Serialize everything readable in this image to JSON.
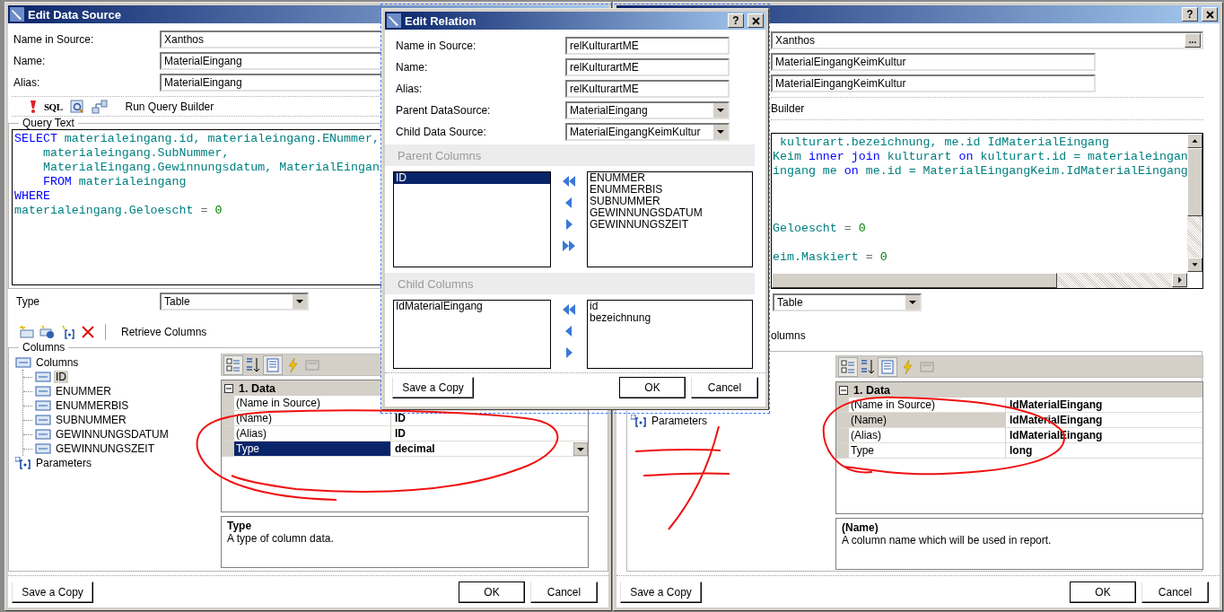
{
  "left_window": {
    "title": "Edit Data Source",
    "fields": [
      {
        "label": "Name in Source:",
        "value": "Xanthos"
      },
      {
        "label": "Name:",
        "value": "MaterialEingang"
      },
      {
        "label": "Alias:",
        "value": "MaterialEingang"
      }
    ],
    "toolbar": {
      "sql": "SQL",
      "label": "Run Query Builder"
    },
    "query": {
      "title": "Query Text",
      "lines": [
        {
          "kind": "code",
          "tokens": [
            {
              "kind": "keyword",
              "text": "SELECT"
            },
            {
              "kind": "ident",
              "text": " materialeingang.id, materialeingang.ENummer,"
            }
          ]
        },
        {
          "kind": "code",
          "tokens": [
            {
              "kind": "ident",
              "text": "    materialeingang.SubNummer,"
            }
          ]
        },
        {
          "kind": "code",
          "tokens": [
            {
              "kind": "ident",
              "text": "    MaterialEingang.Gewinnungsdatum, MaterialEingan"
            }
          ]
        },
        {
          "kind": "code",
          "tokens": [
            {
              "kind": "keyword",
              "text": "    FROM"
            },
            {
              "kind": "ident",
              "text": " materialeingang"
            }
          ]
        },
        {
          "kind": "code",
          "tokens": [
            {
              "kind": "keyword",
              "text": "WHERE"
            }
          ]
        },
        {
          "kind": "code",
          "tokens": [
            {
              "kind": "ident",
              "text": "materialeingang.Geloescht"
            },
            {
              "kind": "plain",
              "text": " = "
            },
            {
              "kind": "number",
              "text": "0"
            }
          ]
        }
      ]
    },
    "type": {
      "label": "Type",
      "value": "Table"
    },
    "columns_toolbar": {
      "label": "Retrieve Columns"
    },
    "columns": {
      "title": "Columns",
      "tree": [
        {
          "label": "Columns",
          "kind": "columns",
          "selected": false,
          "children": [
            {
              "label": "ID",
              "kind": "column",
              "selected": true
            },
            {
              "label": "ENUMMER",
              "kind": "column",
              "selected": false
            },
            {
              "label": "ENUMMERBIS",
              "kind": "column",
              "selected": false
            },
            {
              "label": "SUBNUMMER",
              "kind": "column",
              "selected": false
            },
            {
              "label": "GEWINNUNGSDATUM",
              "kind": "column",
              "selected": false
            },
            {
              "label": "GEWINNUNGSZEIT",
              "kind": "column",
              "selected": false
            }
          ]
        },
        {
          "label": "Parameters",
          "kind": "parameters",
          "selected": false
        }
      ]
    },
    "grid": {
      "focused": true,
      "category": {
        "label": "1. Data",
        "expanded": true
      },
      "rows": [
        {
          "name": "(Name in Source)",
          "selected": false
        },
        {
          "name": "(Name)",
          "value": "ID",
          "selected": false
        },
        {
          "name": "(Alias)",
          "value": "ID",
          "selected": false
        },
        {
          "name": "Type",
          "value": "decimal",
          "selected": true
        }
      ]
    },
    "description": {
      "title": "Type",
      "text": "A type of column data."
    },
    "buttons": {
      "save": "Save a Copy",
      "ok": "OK",
      "cancel": "Cancel"
    }
  },
  "relation_dialog": {
    "title": "Edit Relation",
    "help": "?",
    "fields": [
      {
        "label": "Name in Source:",
        "value": "relKulturartME",
        "kind": "text"
      },
      {
        "label": "Name:",
        "value": "relKulturartME",
        "kind": "text"
      },
      {
        "label": "Alias:",
        "value": "relKulturartME",
        "kind": "text"
      },
      {
        "label": "Parent DataSource:",
        "value": "MaterialEingang",
        "kind": "select"
      },
      {
        "label": "Child Data Source:",
        "value": "MaterialEingangKeimKultur",
        "kind": "select"
      }
    ],
    "sections": [
      {
        "title": "Parent Columns",
        "left": [
          {
            "label": "ID",
            "selected": true
          }
        ],
        "right": [
          {
            "label": "ENUMMER",
            "selected": false
          },
          {
            "label": "ENUMMERBIS",
            "selected": false
          },
          {
            "label": "SUBNUMMER",
            "selected": false
          },
          {
            "label": "GEWINNUNGSDATUM",
            "selected": false
          },
          {
            "label": "GEWINNUNGSZEIT",
            "selected": false
          }
        ]
      },
      {
        "title": "Child Columns",
        "left": [
          {
            "label": "IdMaterialEingang",
            "selected": false
          }
        ],
        "right": [
          {
            "label": "id",
            "selected": false
          },
          {
            "label": "bezeichnung",
            "selected": false
          }
        ]
      }
    ],
    "buttons": {
      "save": "Save a Copy",
      "ok": "OK",
      "cancel": "Cancel"
    }
  },
  "right_window": {
    "help": "?",
    "fields": [
      {
        "value": "Xanthos",
        "kind": "browse",
        "button": "..."
      },
      {
        "value": "MaterialEingangKeimKultur",
        "kind": "text"
      },
      {
        "value": "MaterialEingangKeimKultur",
        "kind": "text"
      }
    ],
    "toolbar": {
      "label": "Builder"
    },
    "query": {
      "lines": [
        {
          "kind": "code",
          "tokens": [
            {
              "kind": "ident",
              "text": " kulturart.bezeichnung, me.id IdMaterialEingang"
            }
          ]
        },
        {
          "kind": "code",
          "tokens": [
            {
              "kind": "ident",
              "text": "Keim"
            },
            {
              "kind": "keyword",
              "text": " inner join"
            },
            {
              "kind": "ident",
              "text": " kulturart"
            },
            {
              "kind": "keyword",
              "text": " on"
            },
            {
              "kind": "ident",
              "text": " kulturart.id = materialeingan"
            }
          ]
        },
        {
          "kind": "code",
          "tokens": [
            {
              "kind": "ident",
              "text": "ingang me"
            },
            {
              "kind": "keyword",
              "text": " on"
            },
            {
              "kind": "ident",
              "text": " me.id = MaterialEingangKeim.IdMaterialEingang"
            }
          ]
        },
        {
          "kind": "blank"
        },
        {
          "kind": "blank"
        },
        {
          "kind": "blank"
        },
        {
          "kind": "code",
          "tokens": [
            {
              "kind": "ident",
              "text": "Geloescht"
            },
            {
              "kind": "plain",
              "text": " = "
            },
            {
              "kind": "number",
              "text": "0"
            }
          ]
        },
        {
          "kind": "blank"
        },
        {
          "kind": "code",
          "tokens": [
            {
              "kind": "ident",
              "text": "eim.Maskiert"
            },
            {
              "kind": "plain",
              "text": " = "
            },
            {
              "kind": "number",
              "text": "0"
            }
          ]
        }
      ]
    },
    "type": {
      "value": "Table"
    },
    "columns_toolbar": {
      "label": "olumns"
    },
    "tree": [
      {
        "label": "Parameters",
        "kind": "parameters",
        "selected": false
      }
    ],
    "grid": {
      "focused": false,
      "category": {
        "label": "1. Data",
        "expanded": true
      },
      "rows": [
        {
          "name": "(Name in Source)",
          "value": "IdMaterialEingang",
          "selected": false
        },
        {
          "name": "(Name)",
          "value": "IdMaterialEingang",
          "selected": true
        },
        {
          "name": "(Alias)",
          "value": "IdMaterialEingang",
          "selected": false
        },
        {
          "name": "Type",
          "value": "long",
          "selected": false
        }
      ]
    },
    "description": {
      "title": "(Name)",
      "text": "A column name which will be used in report."
    },
    "buttons": {
      "save": "Save a Copy",
      "ok": "OK",
      "cancel": "Cancel"
    }
  }
}
